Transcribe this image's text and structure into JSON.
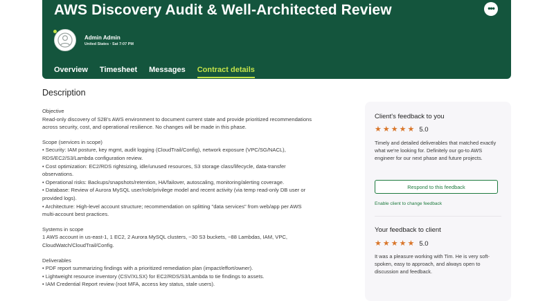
{
  "header": {
    "title": "AWS Discovery Audit & Well-Architected Review",
    "more_icon": "•••",
    "user_name": "Admin Admin",
    "user_meta": "United States · Sat 7:07 PM",
    "tabs": [
      "Overview",
      "Timesheet",
      "Messages",
      "Contract details"
    ],
    "active_tab": "Contract details"
  },
  "description": {
    "heading": "Description",
    "objective_title": "Objective",
    "objective_lines": [
      "Read-only discovery of S2B's AWS environment to document current state and provide prioritized recommendations",
      "across security, cost, and operational resilience. No changes will be made in this phase."
    ],
    "scope_title": "Scope (services in scope)",
    "scope_lines": [
      "• Security: IAM posture, key mgmt, audit logging (CloudTrail/Config), network exposure (VPC/SG/NACL),",
      "RDS/EC2/S3/Lambda configuration review.",
      "• Cost optimization: EC2/RDS rightsizing, idle/unused resources, S3 storage class/lifecycle, data-transfer",
      "observations.",
      "• Operational risks: Backups/snapshots/retention, HA/failover, autoscaling, monitoring/alerting coverage.",
      "• Database: Review of Aurora MySQL user/role/privilege model and recent activity (via temp read-only DB user or",
      "provided logs).",
      "• Architecture: High-level account structure; recommendation on splitting \"data services\" from web/app per AWS",
      "multi-account best practices."
    ],
    "systems_title": "Systems in scope",
    "systems_lines": [
      "1 AWS account in us-east-1, 1 EC2, 2 Aurora MySQL clusters, ~30 S3 buckets, ~88 Lambdas, IAM, VPC,",
      "CloudWatch/CloudTrail/Config."
    ],
    "deliverables_title": "Deliverables",
    "deliverables_lines": [
      "• PDF report summarizing findings with a prioritized remediation plan (impact/effort/owner).",
      "• Lightweight resource inventory (CSV/XLSX) for EC2/RDS/S3/Lambda to tie findings to assets.",
      "• IAM Credential Report review (root MFA, access key status, stale users)."
    ]
  },
  "client_feedback": {
    "title": "Client's feedback to you",
    "rating": 5.0,
    "rating_label": "5.0",
    "text": "Timely and detailed deliverables that matched exactly what we're looking for. Definitely our go-to AWS engineer for our next phase and future projects.",
    "respond_label": "Respond to this feedback",
    "enable_label": "Enable client to change feedback"
  },
  "your_feedback": {
    "title": "Your feedback to client",
    "rating": 5.0,
    "rating_label": "5.0",
    "text": "It was a pleasure working with Tim. He is very soft-spoken, easy to approach, and always open to discussion and feedback."
  },
  "colors": {
    "header_bg": "#14553d",
    "accent_lime": "#c4e34a",
    "star": "#d9762a",
    "link_green": "#1c7a3d",
    "panel_bg": "#f7f6f9"
  }
}
